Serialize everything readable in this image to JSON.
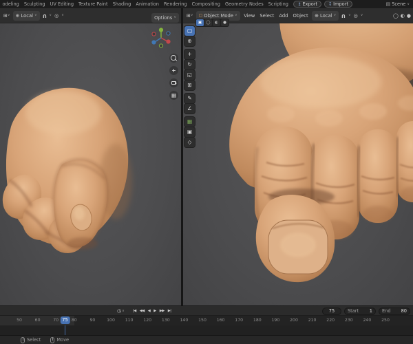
{
  "topbar": {
    "tabs": [
      "odeling",
      "Sculpting",
      "UV Editing",
      "Texture Paint",
      "Shading",
      "Animation",
      "Rendering",
      "Compositing",
      "Geometry Nodes",
      "Scripting"
    ],
    "export_label": "Export",
    "import_label": "Import",
    "scene_label": "Scene"
  },
  "left_viewport": {
    "orientation": "Local",
    "options_label": "Options",
    "nav_controls": [
      "zoom",
      "pan",
      "camera-view",
      "toggle-grid"
    ]
  },
  "right_viewport": {
    "mode": "Object Mode",
    "menus": [
      "View",
      "Select",
      "Add",
      "Object"
    ],
    "orientation": "Local",
    "shading_modes": [
      {
        "name": "shading-wireframe",
        "glyph": "▣",
        "active": true
      },
      {
        "name": "shading-solid",
        "glyph": "◯",
        "active": false
      },
      {
        "name": "shading-material",
        "glyph": "◐",
        "active": false
      },
      {
        "name": "shading-rendered",
        "glyph": "●",
        "active": false
      }
    ]
  },
  "toolbar": {
    "tools": [
      {
        "name": "select-box",
        "glyph": "▢",
        "active": true
      },
      {
        "name": "cursor",
        "glyph": "⊕",
        "active": false
      },
      {
        "name": "move",
        "glyph": "+",
        "active": false
      },
      {
        "name": "rotate",
        "glyph": "↻",
        "active": false
      },
      {
        "name": "scale",
        "glyph": "◱",
        "active": false
      },
      {
        "name": "transform",
        "glyph": "⊞",
        "active": false
      },
      {
        "name": "annotate",
        "glyph": "✎",
        "active": false
      },
      {
        "name": "measure",
        "glyph": "∠",
        "active": false
      },
      {
        "name": "add-cube",
        "glyph": "▦",
        "active": false,
        "color": "#7fae5a"
      },
      {
        "name": "camera",
        "glyph": "▣",
        "active": false
      },
      {
        "name": "empty",
        "glyph": "◇",
        "active": false
      }
    ]
  },
  "timeline": {
    "transport": [
      {
        "name": "jump-to-start",
        "glyph": "|◀"
      },
      {
        "name": "prev-keyframe",
        "glyph": "◀◀"
      },
      {
        "name": "play-reverse",
        "glyph": "◀"
      },
      {
        "name": "play",
        "glyph": "▶"
      },
      {
        "name": "next-keyframe",
        "glyph": "▶▶"
      },
      {
        "name": "jump-to-end",
        "glyph": "▶|"
      }
    ],
    "current_frame": "75",
    "playhead_frame": 75,
    "first_frame": 50,
    "start_label": "Start",
    "start_value": "1",
    "end_label": "End",
    "end_value": "80",
    "frames": [
      "50",
      "60",
      "70",
      "80",
      "90",
      "100",
      "110",
      "120",
      "130",
      "140",
      "150",
      "160",
      "170",
      "180",
      "190",
      "200",
      "210",
      "220",
      "230",
      "240",
      "250"
    ]
  },
  "statusbar": {
    "hints": [
      "Select",
      "Move"
    ]
  },
  "colors": {
    "accent": "#4772b3",
    "skin": "#d8a478",
    "skin_shadow": "#8a5a3a",
    "viewport_bg": "#4c4c4e"
  }
}
